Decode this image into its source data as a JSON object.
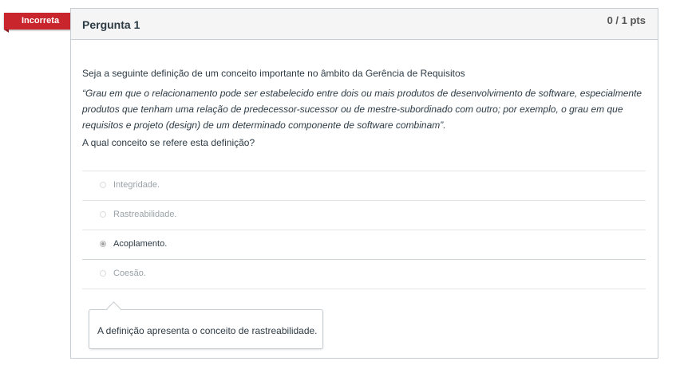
{
  "status_ribbon": {
    "label": "Incorreta",
    "color": "#c9252c"
  },
  "question": {
    "title": "Pergunta 1",
    "points": "0 / 1 pts",
    "prompt": "Seja a seguinte definição de um conceito importante no âmbito da Gerência de Requisitos",
    "quote": "“Grau em que o relacionamento pode ser estabelecido entre dois ou mais produtos de desenvolvimento de software, especialmente produtos que tenham uma relação de predecessor-sucessor ou de mestre-subordinado com outro; por exemplo, o grau em que requisitos e projeto (design) de um determinado componente de software combinam”.",
    "ask": "A qual conceito se refere esta definição?"
  },
  "answers": [
    {
      "label": "Integridade.",
      "selected": false
    },
    {
      "label": "Rastreabilidade.",
      "selected": false
    },
    {
      "label": "Acoplamento.",
      "selected": true
    },
    {
      "label": "Coesão.",
      "selected": false
    }
  ],
  "feedback": {
    "text": "A definição apresenta o conceito de rastreabilidade."
  }
}
